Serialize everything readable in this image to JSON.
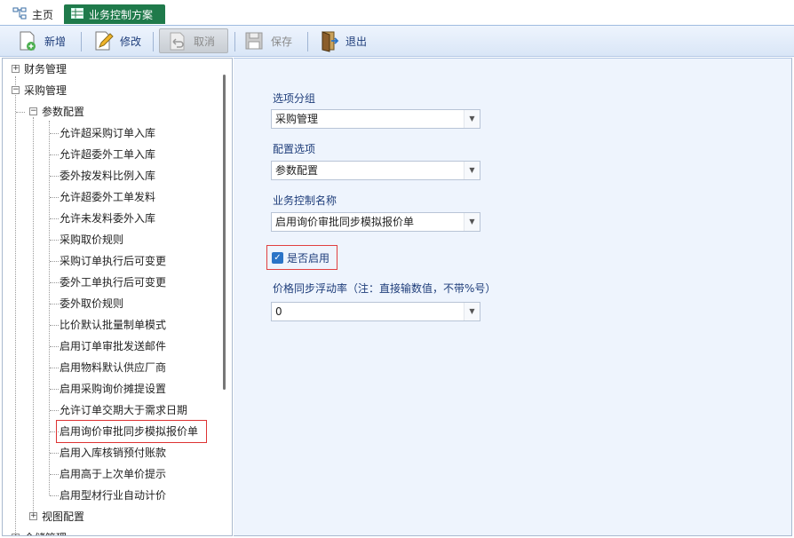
{
  "tabs": {
    "home": "主页",
    "active": "业务控制方案"
  },
  "toolbar": {
    "new": "新增",
    "edit": "修改",
    "cancel": "取消",
    "save": "保存",
    "exit": "退出"
  },
  "tree": {
    "root1": "财务管理",
    "root2": "采购管理",
    "group": "参数配置",
    "items": [
      "允许超采购订单入库",
      "允许超委外工单入库",
      "委外按发料比例入库",
      "允许超委外工单发料",
      "允许未发料委外入库",
      "采购取价规则",
      "采购订单执行后可变更",
      "委外工单执行后可变更",
      "委外取价规则",
      "比价默认批量制单模式",
      "启用订单审批发送邮件",
      "启用物料默认供应厂商",
      "启用采购询价摊提设置",
      "允许订单交期大于需求日期",
      "启用询价审批同步模拟报价单",
      "启用入库核销预付账款",
      "启用高于上次单价提示",
      "启用型材行业自动计价"
    ],
    "group2": "视图配置",
    "root3": "仓储管理"
  },
  "form": {
    "option_group_label": "选项分组",
    "option_group_value": "采购管理",
    "config_option_label": "配置选项",
    "config_option_value": "参数配置",
    "control_name_label": "业务控制名称",
    "control_name_value": "启用询价审批同步模拟报价单",
    "enable_label": "是否启用",
    "rate_label": "价格同步浮动率（注：直接输数值，不带%号）",
    "rate_value": "0"
  },
  "colors": {
    "tab_active": "#1f7a4b",
    "accent": "#2b74c7",
    "highlight_border": "#e04040"
  }
}
